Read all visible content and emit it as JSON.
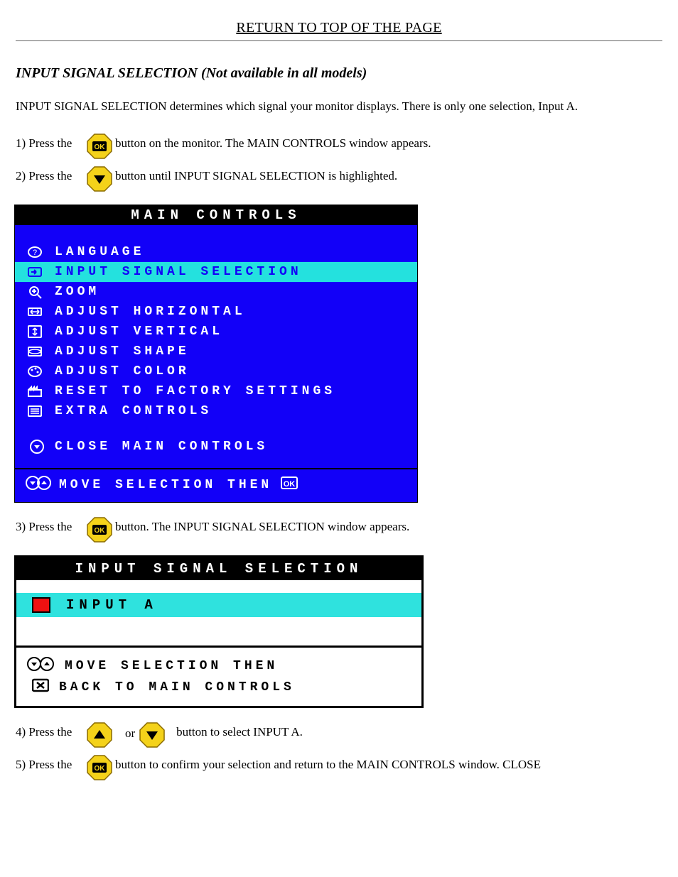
{
  "top_link": "RETURN TO TOP OF THE PAGE",
  "section_title": "INPUT SIGNAL SELECTION (Not available in all models)",
  "intro": "INPUT SIGNAL SELECTION determines which signal your monitor displays. There is only one selection, Input A.",
  "steps": {
    "s1_lead": "1) Press the ",
    "s1_tail": " button on the monitor. The MAIN CONTROLS window appears.",
    "s2_lead": "2) Press the ",
    "s2_tail": " button until INPUT SIGNAL SELECTION is highlighted.",
    "s3_lead": "3) Press the ",
    "s3_tail": " button. The INPUT SIGNAL SELECTION window appears.",
    "s4_lead": "4) Press the ",
    "s4_mid": " or ",
    "s4_tail": " button to select INPUT A.",
    "s5_lead": "5) Press the ",
    "s5_tail": " button to confirm your selection and return to the MAIN CONTROLS window. CLOSE"
  },
  "osd1": {
    "title": "MAIN CONTROLS",
    "items": [
      {
        "label": "LANGUAGE"
      },
      {
        "label": "INPUT SIGNAL SELECTION",
        "hl": true
      },
      {
        "label": "ZOOM"
      },
      {
        "label": "ADJUST HORIZONTAL"
      },
      {
        "label": "ADJUST VERTICAL"
      },
      {
        "label": "ADJUST SHAPE"
      },
      {
        "label": "ADJUST COLOR"
      },
      {
        "label": "RESET TO FACTORY SETTINGS"
      },
      {
        "label": "EXTRA CONTROLS"
      }
    ],
    "close": "CLOSE MAIN CONTROLS",
    "footer": "MOVE SELECTION THEN"
  },
  "osd2": {
    "title": "INPUT SIGNAL SELECTION",
    "row": "INPUT A",
    "foot1": "MOVE SELECTION THEN",
    "foot2": "BACK TO MAIN CONTROLS"
  }
}
